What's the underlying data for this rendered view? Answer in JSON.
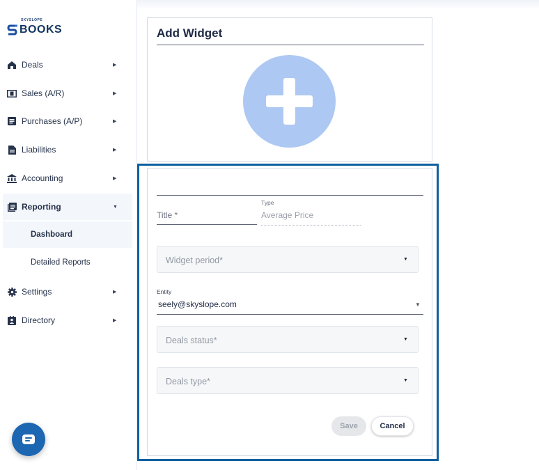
{
  "brand": {
    "small": "SKYSLOPE",
    "name": "BOOKS",
    "logo_icon": "skyslope-s-logo"
  },
  "sidebar": {
    "items": [
      {
        "label": "Deals",
        "icon": "house-icon"
      },
      {
        "label": "Sales (A/R)",
        "icon": "dollar-bill-icon"
      },
      {
        "label": "Purchases (A/P)",
        "icon": "receipt-icon"
      },
      {
        "label": "Liabilities",
        "icon": "document-icon"
      },
      {
        "label": "Accounting",
        "icon": "bank-icon"
      },
      {
        "label": "Reporting",
        "icon": "report-icon"
      },
      {
        "label": "Settings",
        "icon": "gear-icon"
      },
      {
        "label": "Directory",
        "icon": "contact-book-icon"
      }
    ],
    "reporting_sub": [
      {
        "label": "Dashboard"
      },
      {
        "label": "Detailed Reports"
      }
    ]
  },
  "widget": {
    "heading": "Add Widget",
    "title_placeholder": "Title *",
    "type_label": "Type",
    "type_value": "Average Price",
    "period_placeholder": "Widget period*",
    "entity_label": "Entity",
    "entity_value": "seely@skyslope.com",
    "deals_status_placeholder": "Deals status*",
    "deals_type_placeholder": "Deals type*",
    "save_label": "Save",
    "cancel_label": "Cancel"
  },
  "colors": {
    "accent": "#1d66b1",
    "focus_frame": "#0f5f9e",
    "add_circle": "#adc8f2"
  }
}
